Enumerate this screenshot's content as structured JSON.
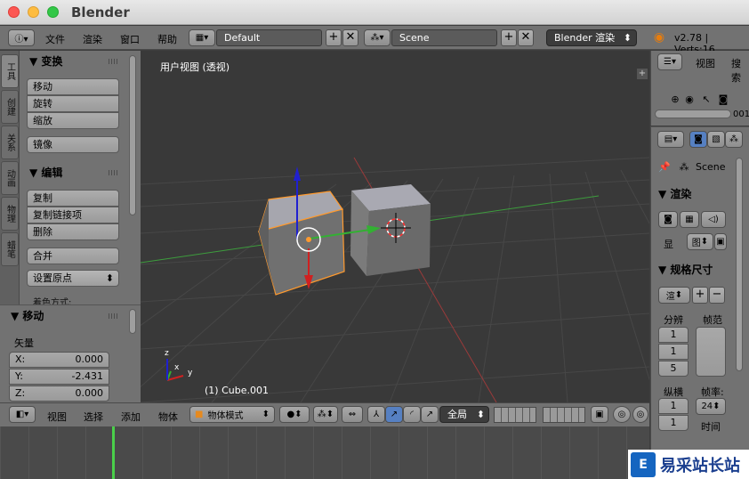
{
  "window": {
    "title": "Blender"
  },
  "info_header": {
    "menus": [
      "文件",
      "渲染",
      "窗口",
      "帮助"
    ],
    "screen_layout": "Default",
    "scene": "Scene",
    "render_engine": "Blender 渲染",
    "version": "v2.78 | Verts:16"
  },
  "toolshelf": {
    "tabs": [
      "工具",
      "创建",
      "关系",
      "动画",
      "物理",
      "蜡笔"
    ],
    "transform_panel": {
      "title": "▼ 变换",
      "buttons": [
        "移动",
        "旋转",
        "缩放"
      ],
      "mirror": "镜像"
    },
    "edit_panel": {
      "title": "▼ 编辑",
      "buttons": [
        "复制",
        "复制链接项",
        "删除"
      ],
      "join": "合并",
      "set_origin": "设置原点",
      "shading": "着色方式:"
    }
  },
  "operator_panel": {
    "title": "▼ 移动",
    "vector_label": "矢量",
    "x_label": "X:",
    "x_value": "0.000",
    "y_label": "Y:",
    "y_value": "-2.431",
    "z_label": "Z:",
    "z_value": "0.000"
  },
  "viewport": {
    "title": "用户视图 (透视)",
    "object_label": "(1) Cube.001",
    "axis_x": "x",
    "axis_y": "y",
    "axis_z": "z"
  },
  "view_header": {
    "menus": [
      "视图",
      "选择",
      "添加",
      "物体"
    ],
    "mode": "物体模式",
    "pivot": "全局"
  },
  "outliner": {
    "menu_view": "视图",
    "menu_search": "搜索",
    "count": "001"
  },
  "properties": {
    "scene_name": "Scene",
    "render_panel": "▼ 渲染",
    "display_label": "显",
    "display_value": "图",
    "dimensions_panel": "▼ 规格尺寸",
    "preset_value": "渲",
    "resolution_label": "分辨",
    "frame_range_label": "帧范",
    "res_values": [
      "1",
      "1",
      "5"
    ],
    "aspect_label": "纵横",
    "fps_label": "帧率:",
    "aspect_values": [
      "1",
      "1"
    ],
    "fps_value": "24",
    "time_label": "时间"
  },
  "watermark": {
    "text": "易采站长站"
  },
  "colors": {
    "accent_selected": "#ff9a2e",
    "axis_x": "#d02020",
    "axis_y": "#33b033",
    "axis_z": "#2020d0"
  }
}
